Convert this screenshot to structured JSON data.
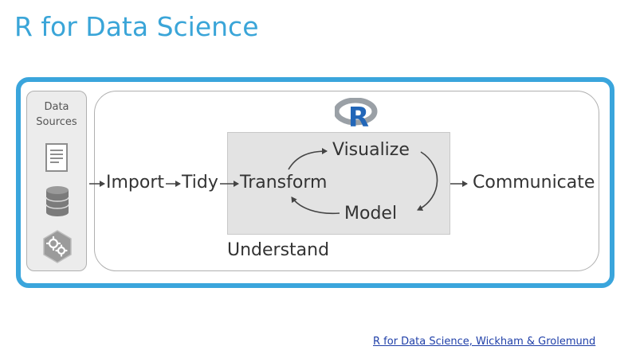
{
  "title": "R for Data Science",
  "sources": {
    "title_line1": "Data",
    "title_line2": "Sources",
    "icons": [
      "document-icon",
      "database-icon",
      "gears-icon"
    ]
  },
  "logo": {
    "letter": "R"
  },
  "steps": {
    "import": "Import",
    "tidy": "Tidy",
    "transform": "Transform",
    "visualize": "Visualize",
    "model": "Model",
    "understand": "Understand",
    "communicate": "Communicate"
  },
  "credit": "R for Data Science, Wickham & Grolemund",
  "colors": {
    "accent": "#3aa5dc",
    "title": "#3aa5d8",
    "understand_fill": "#e3e3e3",
    "logo_blue": "#2266b8",
    "logo_gray": "#9aa0a6",
    "credit_link": "#1f3fa8"
  }
}
